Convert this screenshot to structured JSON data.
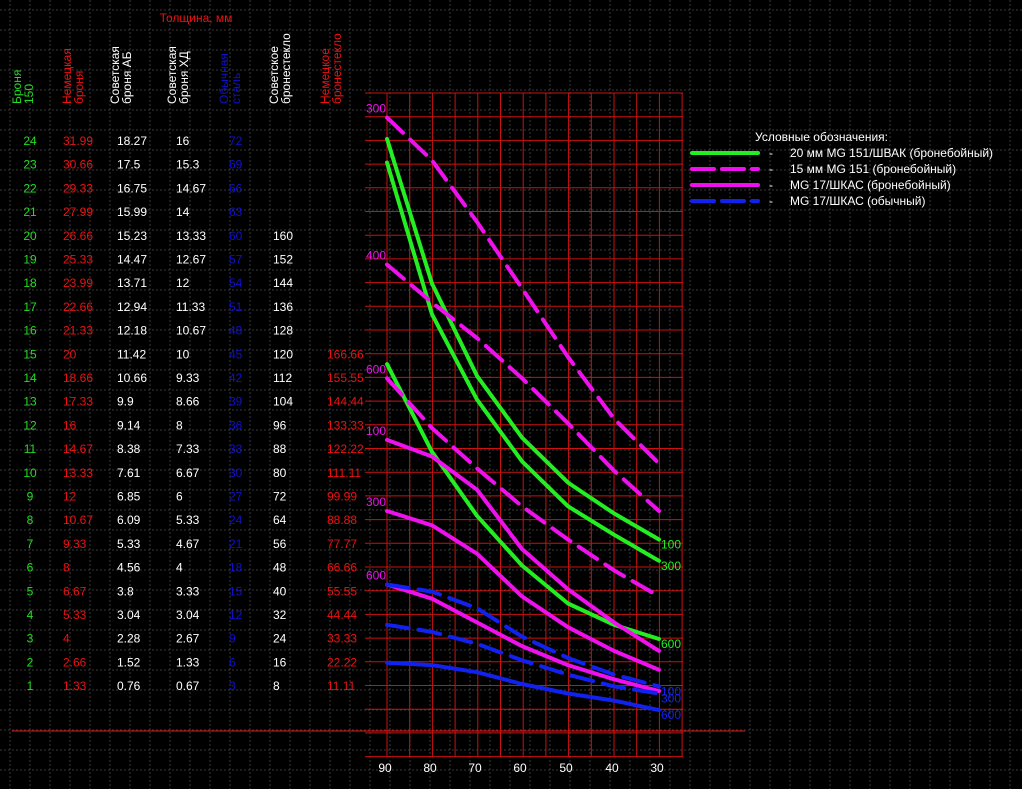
{
  "header": {
    "thickness_label": "Толщина, мм"
  },
  "table": {
    "columns": [
      {
        "label": "Броня 150",
        "lines": [
          "Броня",
          "150"
        ],
        "color": "#22dd22"
      },
      {
        "label": "Немецкая броня",
        "lines": [
          "Немецкая",
          "броня"
        ],
        "color": "#ee1111"
      },
      {
        "label": "Советская броня АБ",
        "lines": [
          "Советская",
          "броня АБ"
        ],
        "color": "#ffffff"
      },
      {
        "label": "Советская броня ХД",
        "lines": [
          "Советская",
          "броня ХД"
        ],
        "color": "#ffffff"
      },
      {
        "label": "Обычная сталь",
        "lines": [
          "Обычная",
          "сталь"
        ],
        "color": "#1111cc"
      },
      {
        "label": "Советское бронестекло",
        "lines": [
          "Советское",
          "бронестекло"
        ],
        "color": "#ffffff"
      },
      {
        "label": "Немецкое бронестекло",
        "lines": [
          "Немецкое",
          "бронестекло"
        ],
        "color": "#ee1111"
      }
    ],
    "rows": [
      [
        "24",
        "31.99",
        "18.27",
        "16",
        "72",
        "",
        ""
      ],
      [
        "23",
        "30.66",
        "17.5",
        "15.3",
        "69",
        "",
        ""
      ],
      [
        "22",
        "29.33",
        "16.75",
        "14.67",
        "66",
        "",
        ""
      ],
      [
        "21",
        "27.99",
        "15.99",
        "14",
        "63",
        "",
        ""
      ],
      [
        "20",
        "26.66",
        "15.23",
        "13.33",
        "60",
        "160",
        ""
      ],
      [
        "19",
        "25.33",
        "14.47",
        "12.67",
        "57",
        "152",
        ""
      ],
      [
        "18",
        "23.99",
        "13.71",
        "12",
        "54",
        "144",
        ""
      ],
      [
        "17",
        "22.66",
        "12.94",
        "11.33",
        "51",
        "136",
        ""
      ],
      [
        "16",
        "21.33",
        "12.18",
        "10.67",
        "48",
        "128",
        ""
      ],
      [
        "15",
        "20",
        "11.42",
        "10",
        "45",
        "120",
        "166.66"
      ],
      [
        "14",
        "18.66",
        "10.66",
        "9.33",
        "42",
        "112",
        "155.55"
      ],
      [
        "13",
        "17.33",
        "9.9",
        "8.66",
        "39",
        "104",
        "144.44"
      ],
      [
        "12",
        "16",
        "9.14",
        "8",
        "36",
        "96",
        "133.33"
      ],
      [
        "11",
        "14.67",
        "8.38",
        "7.33",
        "33",
        "88",
        "122.22"
      ],
      [
        "10",
        "13.33",
        "7.61",
        "6.67",
        "30",
        "80",
        "111.11"
      ],
      [
        "9",
        "12",
        "6.85",
        "6",
        "27",
        "72",
        "99.99"
      ],
      [
        "8",
        "10.67",
        "6.09",
        "5.33",
        "24",
        "64",
        "88.88"
      ],
      [
        "7",
        "9.33",
        "5.33",
        "4.67",
        "21",
        "56",
        "77.77"
      ],
      [
        "6",
        "8",
        "4.56",
        "4",
        "18",
        "48",
        "66.66"
      ],
      [
        "5",
        "6.67",
        "3.8",
        "3.33",
        "15",
        "40",
        "55.55"
      ],
      [
        "4",
        "5.33",
        "3.04",
        "3.04",
        "12",
        "32",
        "44.44"
      ],
      [
        "3",
        "4",
        "2.28",
        "2.67",
        "9",
        "24",
        "33.33"
      ],
      [
        "2",
        "2.66",
        "1.52",
        "1.33",
        "6",
        "16",
        "22.22"
      ],
      [
        "1",
        "1.33",
        "0.76",
        "0.67",
        "3",
        "8",
        "11.11"
      ]
    ]
  },
  "legend": {
    "title": "Условные обозначения:",
    "items": [
      {
        "label": "20 мм MG 151/ШВАК (бронебойный)",
        "color": "#22ee22",
        "style": "solid"
      },
      {
        "label": "15 мм MG 151 (бронебойный)",
        "color": "#ee11ee",
        "style": "dashed"
      },
      {
        "label": "MG 17/ШКАС (бронебойный)",
        "color": "#ee11ee",
        "style": "solid"
      },
      {
        "label": "MG 17/ШКАС (обычный)",
        "color": "#1122ee",
        "style": "dashed"
      }
    ],
    "separator": "-"
  },
  "chart_data": {
    "type": "line",
    "x": [
      90,
      80,
      70,
      60,
      50,
      40,
      30
    ],
    "xlabel": "",
    "x_tick_labels": [
      "90",
      "80",
      "70",
      "60",
      "50",
      "40",
      "30"
    ],
    "ylim": [
      0,
      25
    ],
    "ylabel": "",
    "grid": true,
    "series": [
      {
        "name": "20 мм MG 151/ШВАК (бронебойный)",
        "distance": "100",
        "color": "#22ee22",
        "dash": false,
        "start_label": "",
        "end_label": "100",
        "values": [
          23.8,
          17.7,
          13.8,
          11.2,
          9.3,
          8.0,
          6.9
        ]
      },
      {
        "name": "20 мм MG 151/ШВАК (бронебойный)",
        "distance": "300",
        "color": "#22ee22",
        "dash": false,
        "start_label": "",
        "end_label": "300",
        "values": [
          22.8,
          16.4,
          12.8,
          10.2,
          8.3,
          7.1,
          6.0
        ]
      },
      {
        "name": "20 мм MG 151/ШВАК (бронебойный)",
        "distance": "600",
        "color": "#22ee22",
        "dash": false,
        "start_label": "",
        "end_label": "600",
        "values": [
          14.3,
          10.6,
          7.9,
          5.8,
          4.2,
          3.3,
          2.7
        ]
      },
      {
        "name": "15 мм MG 151 (бронебойный)",
        "distance": "300",
        "color": "#ee11ee",
        "dash": true,
        "start_label": "300",
        "end_label": "",
        "values": [
          24.7,
          22.9,
          20.3,
          17.5,
          14.6,
          12.0,
          10.1
        ]
      },
      {
        "name": "15 мм MG 151 (бронебойный)",
        "distance": "400",
        "color": "#ee11ee",
        "dash": true,
        "start_label": "400",
        "end_label": "",
        "values": [
          18.5,
          16.9,
          15.4,
          13.7,
          11.8,
          9.8,
          8.1
        ]
      },
      {
        "name": "15 мм MG 151 (бронебойный)",
        "distance": "600",
        "color": "#ee11ee",
        "dash": true,
        "start_label": "600",
        "end_label": "",
        "values": [
          13.7,
          11.6,
          9.9,
          8.3,
          6.9,
          5.6,
          4.5
        ]
      },
      {
        "name": "MG 17/ШКАС (бронебойный)",
        "distance": "100",
        "color": "#ee11ee",
        "dash": false,
        "start_label": "100",
        "end_label": "",
        "values": [
          11.1,
          10.4,
          9.0,
          6.5,
          4.8,
          3.4,
          2.2
        ]
      },
      {
        "name": "MG 17/ШКАС (бронебойный)",
        "distance": "300",
        "color": "#ee11ee",
        "dash": false,
        "start_label": "300",
        "end_label": "",
        "values": [
          8.1,
          7.5,
          6.3,
          4.5,
          3.2,
          2.2,
          1.4
        ]
      },
      {
        "name": "MG 17/ШКАС (бронебойный)",
        "distance": "600",
        "color": "#ee11ee",
        "dash": false,
        "start_label": "600",
        "end_label": "",
        "values": [
          5.0,
          4.4,
          3.4,
          2.4,
          1.6,
          1.0,
          0.5
        ]
      },
      {
        "name": "MG 17/ШКАС (обычный)",
        "distance": "100",
        "color": "#1122ee",
        "dash": true,
        "start_label": "",
        "end_label": "100",
        "values": [
          5.0,
          4.7,
          4.0,
          2.8,
          1.9,
          1.2,
          0.7
        ]
      },
      {
        "name": "MG 17/ШКАС (обычный)",
        "distance": "300",
        "color": "#1122ee",
        "dash": true,
        "start_label": "",
        "end_label": "300",
        "values": [
          3.3,
          3.0,
          2.5,
          1.8,
          1.2,
          0.7,
          0.4
        ]
      },
      {
        "name": "MG 17/ШКАС (обычный)",
        "distance": "600",
        "color": "#1122ee",
        "dash": false,
        "start_label": "",
        "end_label": "600",
        "values": [
          1.7,
          1.6,
          1.3,
          0.8,
          0.4,
          0.1,
          -0.3
        ]
      }
    ]
  }
}
